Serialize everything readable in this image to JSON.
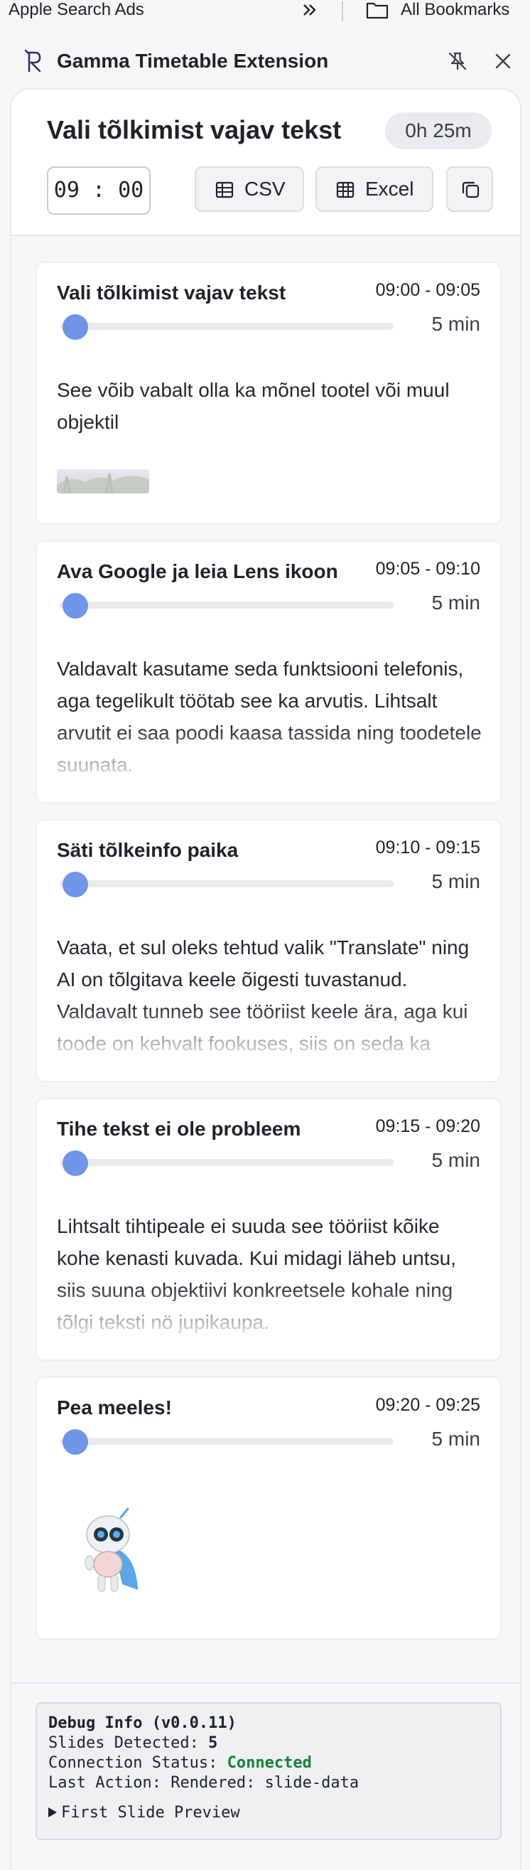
{
  "bookmarks_bar": {
    "left_item": "Apple Search Ads",
    "right_item": "All Bookmarks",
    "chevron_icon": "double-chevron-right-icon",
    "folder_icon": "folder-icon"
  },
  "extension": {
    "title": "Gamma Timetable Extension",
    "logo_icon": "gamma-logo-icon",
    "pin_icon": "unpin-icon",
    "close_icon": "close-icon"
  },
  "panel": {
    "title": "Vali tõlkimist vajav tekst",
    "total_duration": "0h 25m",
    "start_time": "09 : 00",
    "buttons": {
      "csv": "CSV",
      "excel": "Excel",
      "copy_icon": "copy-icon"
    }
  },
  "slides": [
    {
      "title": "Vali tõlkimist vajav tekst",
      "time_range": "09:00 - 09:05",
      "duration": "5 min",
      "text": "See võib vabalt olla ka mõnel tootel või muul objektil",
      "has_image": true
    },
    {
      "title": "Ava Google ja leia Lens ikoon",
      "time_range": "09:05 - 09:10",
      "duration": "5 min",
      "text": "Valdavalt kasutame seda funktsiooni telefonis, aga tegelikult töötab see ka arvutis. Lihtsalt arvutit ei saa poodi kaasa tassida ning toodetele suunata."
    },
    {
      "title": "Säti tõlkeinfo paika",
      "time_range": "09:10 - 09:15",
      "duration": "5 min",
      "text": "Vaata, et sul oleks tehtud valik \"Translate\" ning AI on tõlgitava keele õigesti tuvastanud. Valdavalt tunneb see tööriist keele ära, aga kui toode on kehvalt fookuses, siis on seda ka"
    },
    {
      "title": "Tihe tekst ei ole probleem",
      "time_range": "09:15 - 09:20",
      "duration": "5 min",
      "text": "Lihtsalt tihtipeale ei suuda see tööriist kõike kohe kenasti kuvada. Kui midagi läheb untsu, siis suuna objektiivi konkreetsele kohale ning tõlgi teksti nö jupikaupa."
    },
    {
      "title": "Pea meeles!",
      "time_range": "09:20 - 09:25",
      "duration": "5 min",
      "text": "",
      "has_robot": true
    }
  ],
  "debug": {
    "title": "Debug Info (v0.0.11)",
    "slides_label": "Slides Detected:",
    "slides_value": "5",
    "status_label": "Connection Status:",
    "status_value": "Connected",
    "action_label": "Last Action:",
    "action_value": "Rendered: slide-data",
    "preview_label": "First Slide Preview",
    "status_color": "#1a7f37"
  },
  "colors": {
    "accent": "#6f95e6",
    "panel_bg": "#f5f6f8"
  }
}
